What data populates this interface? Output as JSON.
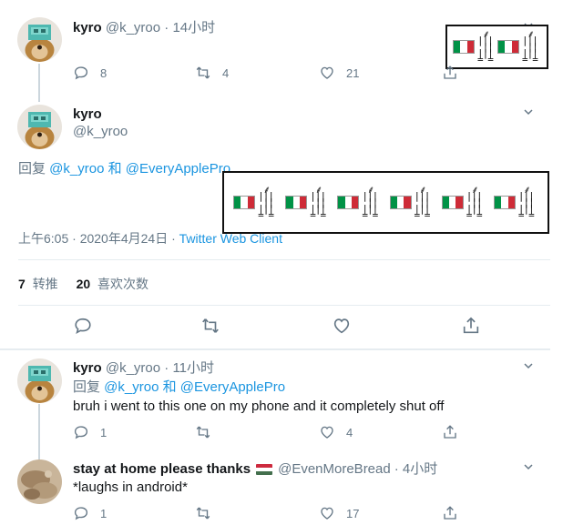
{
  "colors": {
    "accent": "#1b95e0",
    "muted": "#657786",
    "divider": "#e6ecf0",
    "thread_line": "#ccd6dd"
  },
  "tweet1": {
    "name": "kyro",
    "handle": "@k_yroo",
    "time": "· 14小时",
    "reply_count": "8",
    "retweet_count": "4",
    "like_count": "21",
    "glyph_count": 2
  },
  "main_tweet": {
    "name": "kyro",
    "handle": "@k_yroo",
    "reply_prefix": "回复 ",
    "reply_user1": "@k_yroo",
    "reply_and": " 和 ",
    "reply_user2": "@EveryApplePro",
    "glyph_count": 6,
    "timestamp": "上午6:05 · 2020年4月24日 · ",
    "client": "Twitter Web Client",
    "retweets_num": "7",
    "retweets_label": "转推",
    "likes_num": "20",
    "likes_label": "喜欢次数"
  },
  "reply1": {
    "name": "kyro",
    "handle": "@k_yroo",
    "time": "· 11小时",
    "reply_prefix": "回复 ",
    "reply_user1": "@k_yroo",
    "reply_and": " 和 ",
    "reply_user2": "@EveryApplePro",
    "text": "bruh i went to this one on my phone and it completely shut off",
    "reply_count": "1",
    "like_count": "4"
  },
  "reply2": {
    "name": "stay at home please thanks",
    "flag_emoji": "hungary-flag",
    "handle": "@EvenMoreBread",
    "time": "· 4小时",
    "text": "*laughs in android*",
    "reply_count": "1",
    "like_count": "17"
  }
}
